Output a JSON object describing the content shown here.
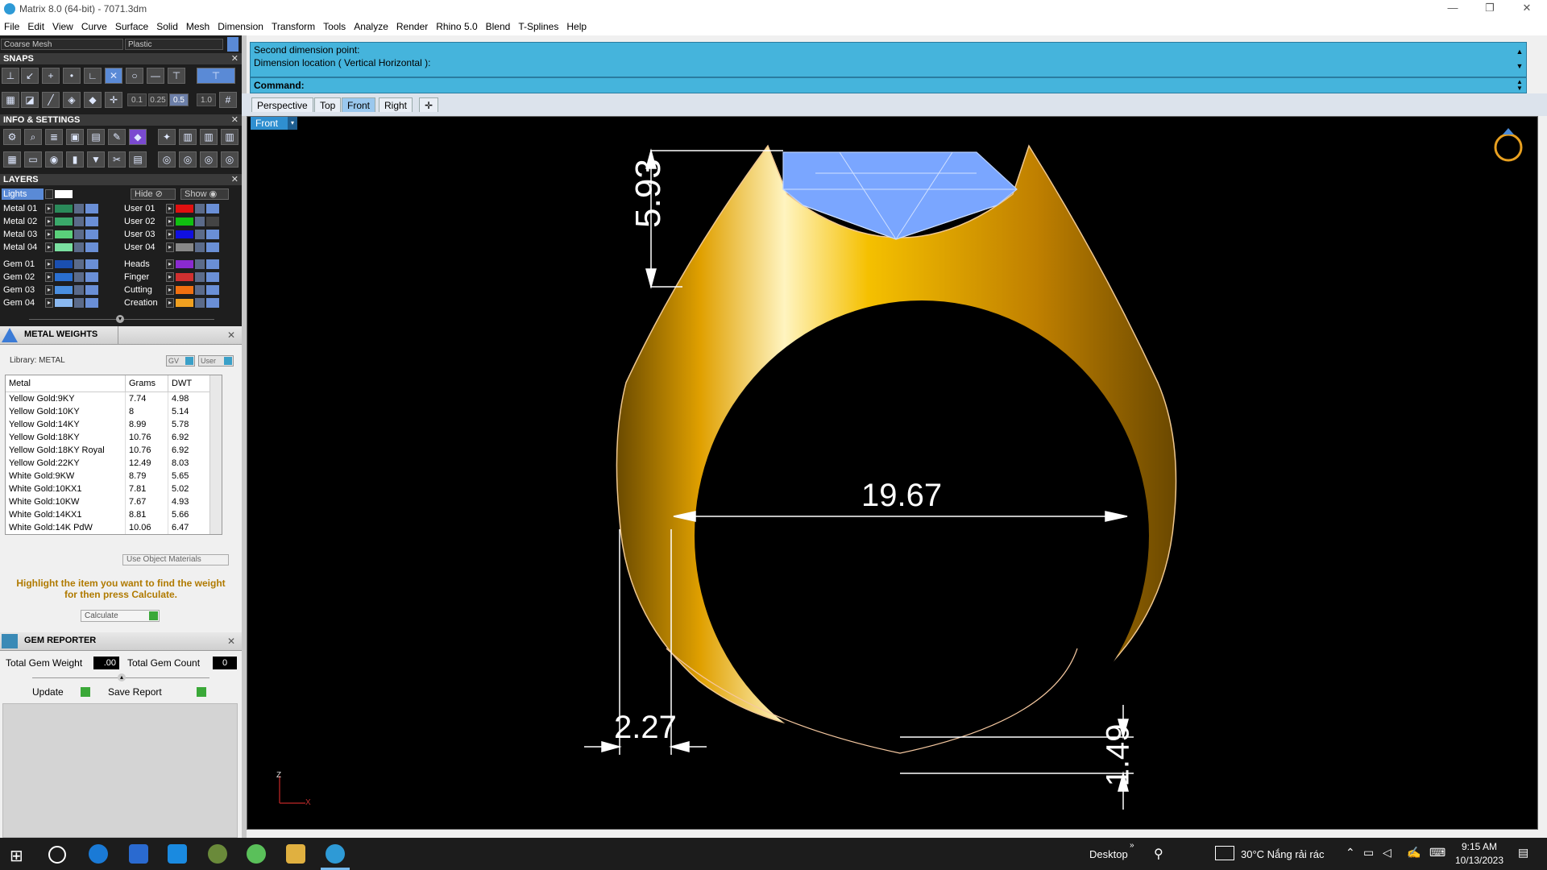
{
  "window": {
    "title": "Matrix 8.0 (64-bit) - 7071.3dm",
    "minimize": "—",
    "maximize": "❐",
    "close": "✕"
  },
  "menu": [
    "File",
    "Edit",
    "View",
    "Curve",
    "Surface",
    "Solid",
    "Mesh",
    "Dimension",
    "Transform",
    "Tools",
    "Analyze",
    "Render",
    "Rhino 5.0",
    "Blend",
    "T-Splines",
    "Help"
  ],
  "left": {
    "mesh_combo": "Coarse Mesh",
    "material_combo": "Plastic",
    "snaps_title": "SNAPS",
    "snap_values": [
      "0.1",
      "0.25",
      "0.5",
      "1.0"
    ],
    "info_title": "INFO & SETTINGS",
    "layers_title": "LAYERS",
    "lights_label": "Lights",
    "hide_label": "Hide",
    "show_label": "Show",
    "layers_left": [
      {
        "name": "Metal 01",
        "color": "#2a8a5a"
      },
      {
        "name": "Metal 02",
        "color": "#3aa86a"
      },
      {
        "name": "Metal 03",
        "color": "#5ad07a"
      },
      {
        "name": "Metal 04",
        "color": "#7ae0a0"
      },
      {
        "name": "Gem 01",
        "color": "#1a4fb0"
      },
      {
        "name": "Gem 02",
        "color": "#2a6fd0"
      },
      {
        "name": "Gem 03",
        "color": "#4a8fe0"
      },
      {
        "name": "Gem 04",
        "color": "#8ab8f0"
      }
    ],
    "layers_right": [
      {
        "name": "User 01",
        "color": "#e01010"
      },
      {
        "name": "User 02",
        "color": "#10c010"
      },
      {
        "name": "User 03",
        "color": "#1010e0"
      },
      {
        "name": "User 04",
        "color": "#888888"
      },
      {
        "name": "Heads",
        "color": "#8a2ad0"
      },
      {
        "name": "Finger",
        "color": "#d03030"
      },
      {
        "name": "Cutting",
        "color": "#f07010"
      },
      {
        "name": "Creation",
        "color": "#f0a020"
      }
    ]
  },
  "metal_weights": {
    "title": "METAL WEIGHTS",
    "library": "Library: METAL",
    "gv": "GV",
    "user": "User",
    "headers": [
      "Metal",
      "Grams",
      "DWT"
    ],
    "rows": [
      [
        "Yellow Gold:9KY",
        "7.74",
        "4.98"
      ],
      [
        "Yellow Gold:10KY",
        "8",
        "5.14"
      ],
      [
        "Yellow Gold:14KY",
        "8.99",
        "5.78"
      ],
      [
        "Yellow Gold:18KY",
        "10.76",
        "6.92"
      ],
      [
        "Yellow Gold:18KY Royal",
        "10.76",
        "6.92"
      ],
      [
        "Yellow Gold:22KY",
        "12.49",
        "8.03"
      ],
      [
        "White Gold:9KW",
        "8.79",
        "5.65"
      ],
      [
        "White Gold:10KX1",
        "7.81",
        "5.02"
      ],
      [
        "White Gold:10KW",
        "7.67",
        "4.93"
      ],
      [
        "White Gold:14KX1",
        "8.81",
        "5.66"
      ],
      [
        "White Gold:14K PdW",
        "10.06",
        "6.47"
      ]
    ],
    "use_object_materials": "Use Object Materials",
    "hint": "Highlight the item you want to find the weight for then press Calculate.",
    "calculate": "Calculate"
  },
  "gem_reporter": {
    "title": "GEM REPORTER",
    "total_weight_label": "Total Gem Weight",
    "total_weight_value": ".00",
    "total_count_label": "Total Gem Count",
    "total_count_value": "0",
    "update": "Update",
    "save_report": "Save Report"
  },
  "command": {
    "line1": "Second dimension point:",
    "line2": "Dimension location ( Vertical  Horizontal ):",
    "prompt": "Command:"
  },
  "viewport_tabs": [
    "Perspective",
    "Top",
    "Front",
    "Right"
  ],
  "active_tab": "Front",
  "viewport_label": "Front",
  "dimensions": {
    "top_height": "5.93",
    "inner_diameter": "19.67",
    "bottom_left": "2.27",
    "bottom_right": "1.49"
  },
  "axis": {
    "z": "Z",
    "x": "X"
  },
  "colors": {
    "gold": "#f0b400",
    "gem": "#7aa6ff",
    "cmd": "#45b4dc",
    "viewport_bg": "#000000"
  },
  "taskbar": {
    "desktop": "Desktop",
    "weather": "30°C  Nắng rải rác",
    "time": "9:15 AM",
    "date": "10/13/2023"
  }
}
